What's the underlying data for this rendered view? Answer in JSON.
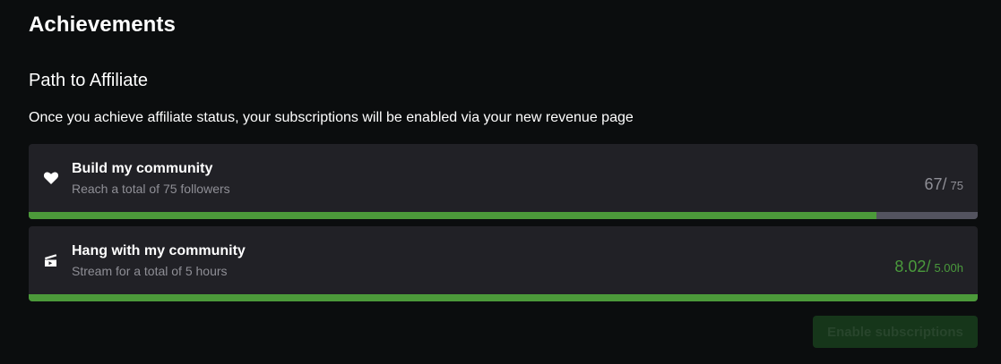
{
  "header": {
    "title": "Achievements"
  },
  "section": {
    "title": "Path to Affiliate",
    "description": "Once you achieve affiliate status, your subscriptions will be enabled via your new revenue page"
  },
  "achievements": [
    {
      "icon": "heart-icon",
      "title": "Build my community",
      "subtitle": "Reach a total of 75 followers",
      "current": "67/",
      "goal": "75",
      "progress": 0.893,
      "status_color": "#8f8f96"
    },
    {
      "icon": "video-camera-icon",
      "title": "Hang with my community",
      "subtitle": "Stream for a total of 5 hours",
      "current": "8.02/",
      "goal": "5.00h",
      "progress": 1.0,
      "status_color": "#4a9a3c"
    }
  ],
  "actions": {
    "enable_label": "Enable subscriptions",
    "enable_disabled": true
  },
  "colors": {
    "background": "#0b0d0e",
    "card": "#212126",
    "progress_fill": "#4c9a3a",
    "progress_track": "#53535f"
  }
}
